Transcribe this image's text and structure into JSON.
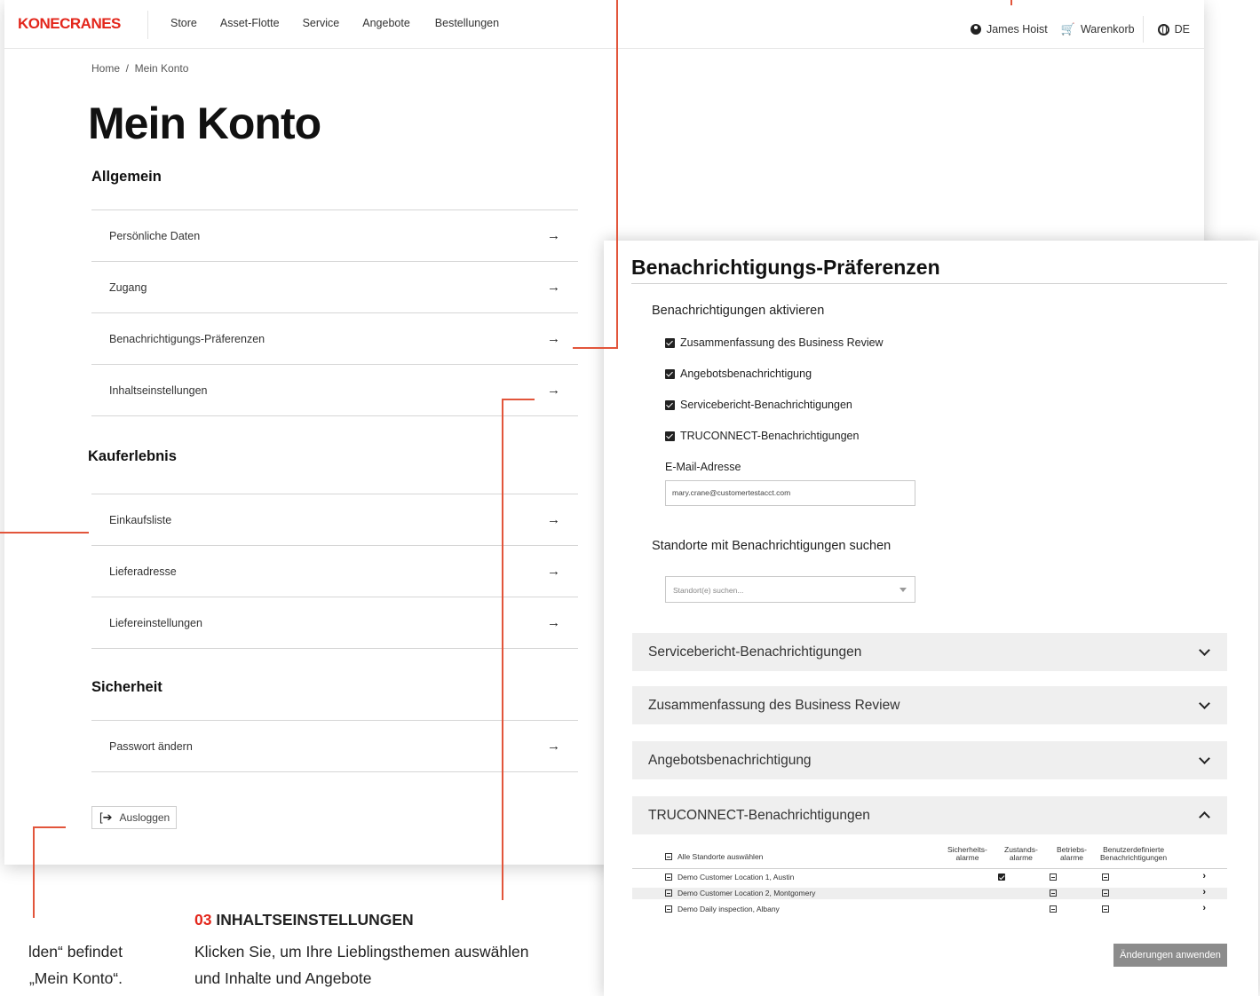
{
  "header": {
    "logo": "KONECRANES",
    "nav": [
      "Store",
      "Asset-Flotte",
      "Service",
      "Angebote",
      "Bestellungen"
    ],
    "user": "James Hoist",
    "cart": "Warenkorb",
    "lang": "DE"
  },
  "breadcrumb": "Home  /  Mein Konto",
  "page_title": "Mein Konto",
  "sections": {
    "general": {
      "title": "Allgemein",
      "items": [
        "Persönliche Daten",
        "Zugang",
        "Benachrichtigungs-Präferenzen",
        "Inhaltseinstellungen"
      ]
    },
    "buying": {
      "title": "Kauferlebnis",
      "items": [
        "Einkaufsliste",
        "Lieferadresse",
        "Liefereinstellungen"
      ]
    },
    "security": {
      "title": "Sicherheit",
      "items": [
        "Passwort ändern"
      ]
    }
  },
  "arrow_glyph": "→",
  "logout_label": "Ausloggen",
  "notifications": {
    "title": "Benachrichtigungs-Präferenzen",
    "activate_label": "Benachrichtigungen aktivieren",
    "checkboxes": [
      "Zusammenfassung des Business Review",
      "Angebotsbenachrichtigung",
      "Servicebericht-Benachrichtigungen",
      "TRUCONNECT-Benachrichtigungen"
    ],
    "email_label": "E-Mail-Adresse",
    "email_value": "mary.crane@customertestacct.com",
    "locations_title": "Standorte mit Benachrichtigungen suchen",
    "locations_placeholder": "Standort(e) suchen...",
    "accordions": [
      "Servicebericht-Benachrichtigungen",
      "Zusammenfassung des Business Review",
      "Angebotsbenachrichtigung",
      "TRUCONNECT-Benachrichtigungen"
    ],
    "table": {
      "select_all": "Alle Standorte auswählen",
      "col_safety": [
        "Sicherheits-",
        "alarme"
      ],
      "col_condition": [
        "Zustands-",
        "alarme"
      ],
      "col_operation": [
        "Betriebs-",
        "alarme"
      ],
      "col_custom": [
        "Benutzerdefinierte",
        "Benachrichtigungen"
      ],
      "rows": [
        "Demo Customer Location 1, Austin",
        "Demo Customer Location 2, Montgomery",
        "Demo Daily inspection, Albany"
      ]
    },
    "apply_label": "Änderungen anwenden"
  },
  "callout": {
    "number": "03",
    "heading": "INHALTSEINSTELLUNGEN",
    "body": "Klicken Sie, um Ihre Lieblingsthemen auswählen und Inhalte und Angebote",
    "left_line1": "lden“ befindet",
    "left_line2": "„Mein Konto“."
  }
}
